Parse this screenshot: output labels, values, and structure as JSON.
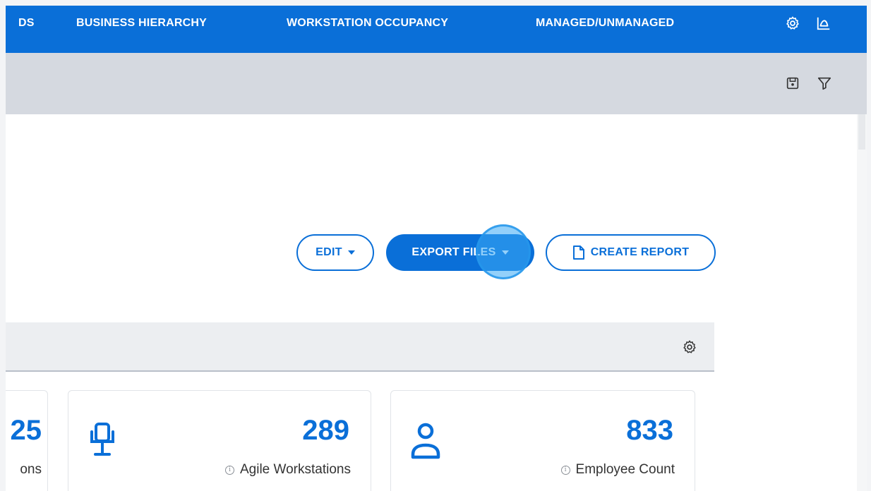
{
  "nav": {
    "items": [
      {
        "label": "DS"
      },
      {
        "label": "BUSINESS HIERARCHY"
      },
      {
        "label": "WORKSTATION OCCUPANCY"
      },
      {
        "label": "MANAGED/UNMANAGED"
      }
    ],
    "icons": [
      "gear-icon",
      "area-chart-icon"
    ]
  },
  "subbar": {
    "icons": [
      "save-icon",
      "filter-icon"
    ]
  },
  "actions": {
    "edit_label": "EDIT",
    "export_label": "EXPORT FILES",
    "create_report_label": "CREATE REPORT"
  },
  "panel": {
    "icon": "gear-icon"
  },
  "cards": [
    {
      "value": "25",
      "label": "ons"
    },
    {
      "value": "289",
      "label": "Agile Workstations",
      "icon": "office-chair-icon"
    },
    {
      "value": "833",
      "label": "Employee Count",
      "icon": "person-icon"
    }
  ],
  "colors": {
    "primary": "#0a6fd8",
    "subbar": "#d5d9e0",
    "panel_bar": "#eceef1"
  }
}
